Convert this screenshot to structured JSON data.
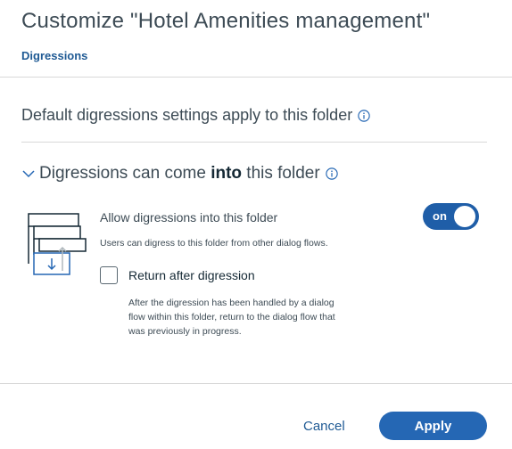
{
  "dialog": {
    "title": "Customize \"Hotel Amenities management\""
  },
  "tabs": [
    {
      "label": "Digressions",
      "active": true
    }
  ],
  "defaults": {
    "heading": "Default digressions settings apply to this folder",
    "info_icon": "info-circle-icon"
  },
  "section": {
    "heading_prefix": "Digressions can come ",
    "heading_bold": "into",
    "heading_suffix": " this folder",
    "chevron_icon": "chevron-down-icon",
    "info_icon": "info-circle-icon",
    "illustration_icon": "digression-flow-icon"
  },
  "allow": {
    "label": "Allow digressions into this folder",
    "description": "Users can digress to this folder from other dialog flows.",
    "toggle_text": "on",
    "toggle_on": true
  },
  "return_after": {
    "label": "Return after digression",
    "checked": false,
    "description_lines": [
      "After the digression has been handled by a dialog",
      "flow within this folder, return to the dialog flow that",
      "was previously in progress."
    ]
  },
  "footer": {
    "cancel_label": "Cancel",
    "apply_label": "Apply"
  },
  "colors": {
    "accent": "#2567b4",
    "link": "#1f5a94",
    "toggle_on": "#1f5ea8"
  }
}
